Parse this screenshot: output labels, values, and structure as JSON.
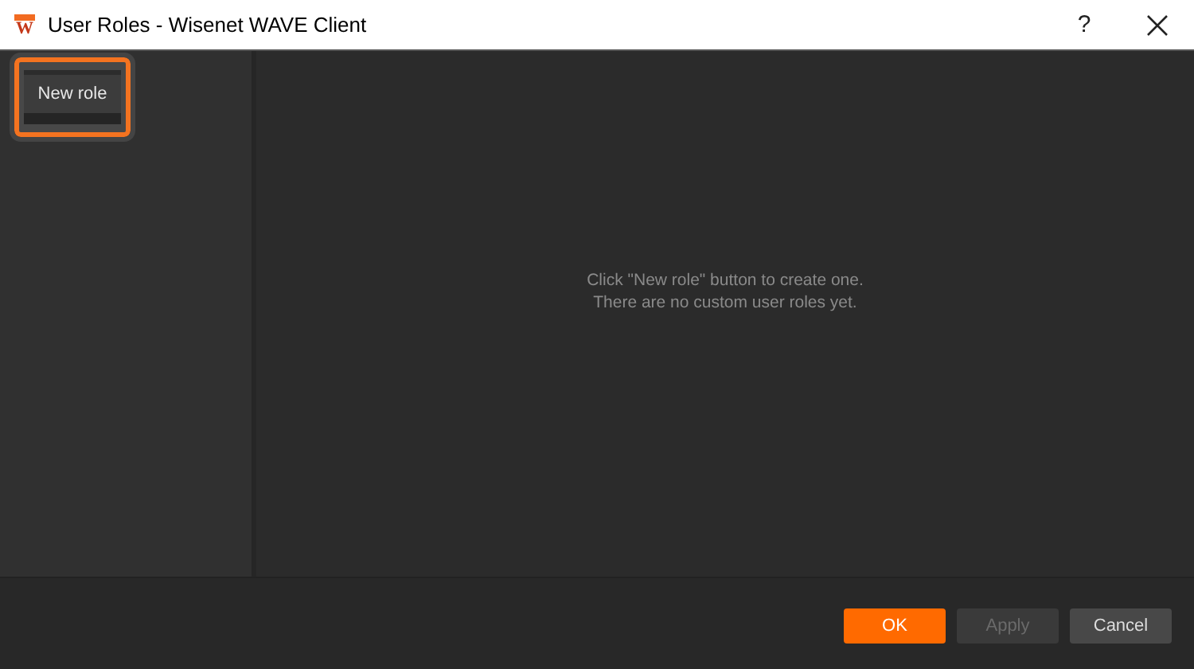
{
  "window": {
    "logo_letter": "W",
    "title": "User Roles - Wisenet WAVE Client",
    "help": "?"
  },
  "sidebar": {
    "new_role_button": {
      "label": "New role",
      "highlighted": true
    }
  },
  "main": {
    "empty_message": [
      "Click \"New role\" button to create one.",
      "There are no custom user roles yet."
    ]
  },
  "buttons": [
    {
      "label": "OK",
      "kind": "primary",
      "disabled": false
    },
    {
      "label": "Apply",
      "kind": "normal",
      "disabled": true
    },
    {
      "label": "Cancel",
      "kind": "normal",
      "disabled": false
    }
  ]
}
